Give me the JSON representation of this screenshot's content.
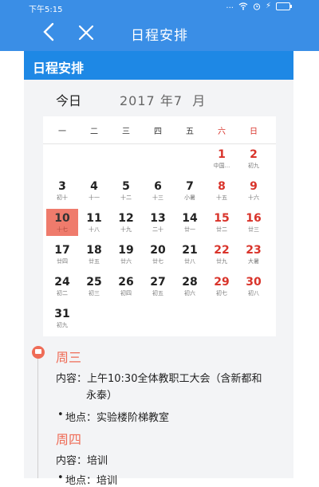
{
  "status_bar": {
    "time": "下午5:15",
    "dots": "...",
    "bolt": "⚡"
  },
  "app_bar": {
    "title": "日程安排"
  },
  "section": {
    "title": "日程安排"
  },
  "calendar": {
    "today_label": "今日",
    "year": "2017",
    "year_unit": "年",
    "month": "7",
    "month_unit": "月",
    "weekdays": [
      "一",
      "二",
      "三",
      "四",
      "五",
      "六",
      "日"
    ],
    "days": [
      {
        "num": "1",
        "lunar": "中国..."
      },
      {
        "num": "2",
        "lunar": "初九"
      },
      {
        "num": "3",
        "lunar": "初十"
      },
      {
        "num": "4",
        "lunar": "十一"
      },
      {
        "num": "5",
        "lunar": "十二"
      },
      {
        "num": "6",
        "lunar": "十三"
      },
      {
        "num": "7",
        "lunar": "小暑"
      },
      {
        "num": "8",
        "lunar": "十五"
      },
      {
        "num": "9",
        "lunar": "十六"
      },
      {
        "num": "10",
        "lunar": "十七"
      },
      {
        "num": "11",
        "lunar": "十八"
      },
      {
        "num": "12",
        "lunar": "十九"
      },
      {
        "num": "13",
        "lunar": "二十"
      },
      {
        "num": "14",
        "lunar": "廿一"
      },
      {
        "num": "15",
        "lunar": "廿二"
      },
      {
        "num": "16",
        "lunar": "廿三"
      },
      {
        "num": "17",
        "lunar": "廿四"
      },
      {
        "num": "18",
        "lunar": "廿五"
      },
      {
        "num": "19",
        "lunar": "廿六"
      },
      {
        "num": "20",
        "lunar": "廿七"
      },
      {
        "num": "21",
        "lunar": "廿八"
      },
      {
        "num": "22",
        "lunar": "廿九"
      },
      {
        "num": "23",
        "lunar": "大暑"
      },
      {
        "num": "24",
        "lunar": "初二"
      },
      {
        "num": "25",
        "lunar": "初三"
      },
      {
        "num": "26",
        "lunar": "初四"
      },
      {
        "num": "27",
        "lunar": "初五"
      },
      {
        "num": "28",
        "lunar": "初六"
      },
      {
        "num": "29",
        "lunar": "初七"
      },
      {
        "num": "30",
        "lunar": "初八"
      },
      {
        "num": "31",
        "lunar": "初九"
      }
    ]
  },
  "schedule": {
    "wed": "周三",
    "wed_content_line1": "内容：上午10:30全体教职工大会（含新都和",
    "wed_content_line2": "永泰）",
    "wed_location": "地点：实验楼阶梯教室",
    "thu": "周四",
    "thu_content": "内容：培训",
    "thu_location_partial": "地点：培训"
  }
}
